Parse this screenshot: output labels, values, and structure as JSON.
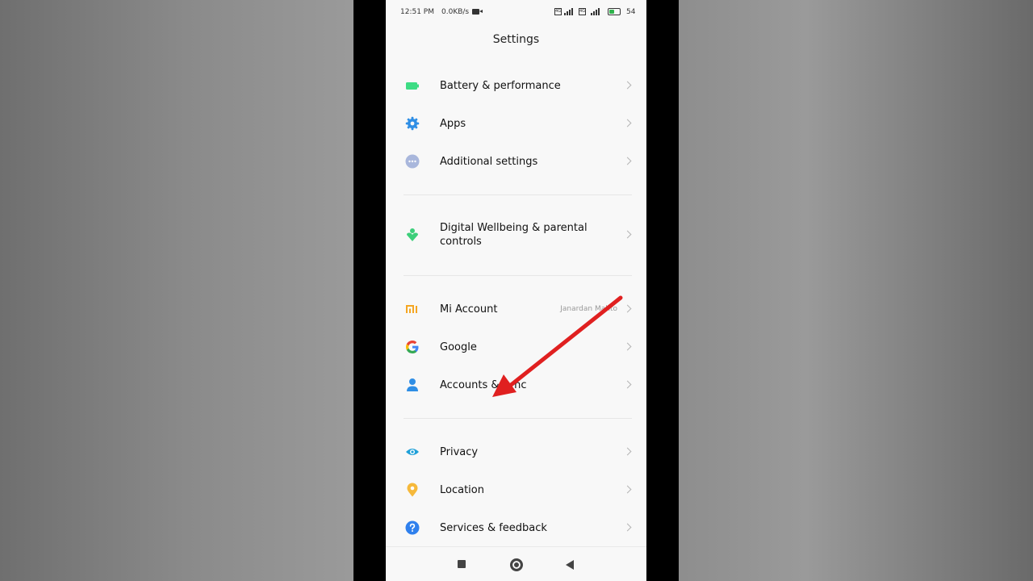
{
  "status_bar": {
    "time": "12:51 PM",
    "net_speed": "0.0KB/s",
    "sim1": "4G",
    "sim2": "4G",
    "battery_percent": "54",
    "battery_level": 0.54
  },
  "header": {
    "title": "Settings"
  },
  "groups": [
    [
      {
        "id": "battery",
        "label": "Battery & performance",
        "icon": "battery-icon",
        "color": "#3ddc84"
      },
      {
        "id": "apps",
        "label": "Apps",
        "icon": "gear-icon",
        "color": "#2f8ee5"
      },
      {
        "id": "additional",
        "label": "Additional settings",
        "icon": "more-dots-icon",
        "color": "#9fb0d6"
      }
    ],
    [
      {
        "id": "wellbeing",
        "label": "Digital Wellbeing & parental controls",
        "icon": "wellbeing-icon",
        "color": "#3ccf7a"
      }
    ],
    [
      {
        "id": "mi-account",
        "label": "Mi Account",
        "value": "Janardan Mahto",
        "icon": "mi-logo-icon",
        "color": "#f5a623"
      },
      {
        "id": "google",
        "label": "Google",
        "icon": "google-icon",
        "color": "#4285f4"
      },
      {
        "id": "accounts",
        "label": "Accounts & sync",
        "icon": "person-icon",
        "color": "#2f8ee5"
      }
    ],
    [
      {
        "id": "privacy",
        "label": "Privacy",
        "icon": "eye-icon",
        "color": "#1fa0d8"
      },
      {
        "id": "location",
        "label": "Location",
        "icon": "location-pin-icon",
        "color": "#f6b93b"
      },
      {
        "id": "services",
        "label": "Services & feedback",
        "icon": "help-icon",
        "color": "#2f80ed"
      }
    ]
  ],
  "annotation": {
    "arrow_color": "#e02020"
  },
  "nav": {
    "recents": "square-icon",
    "home": "home-circle-icon",
    "back": "back-triangle-icon"
  }
}
